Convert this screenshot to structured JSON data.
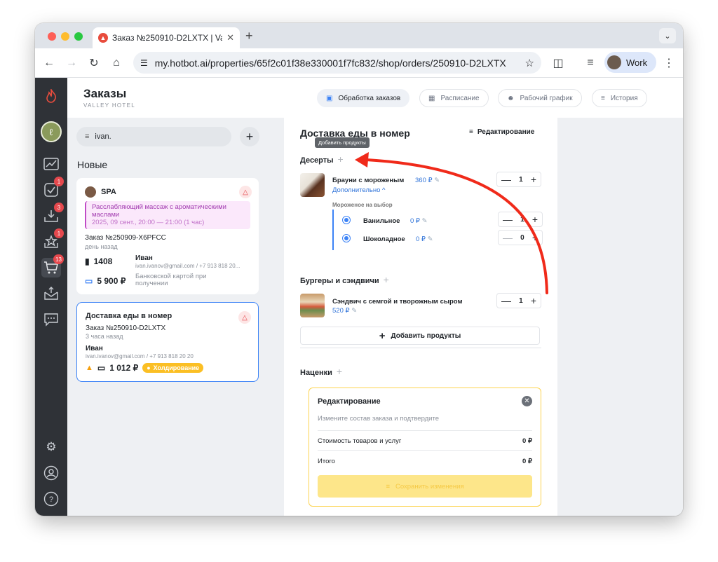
{
  "browser": {
    "tab_title": "Заказ №250910-D2LXTX | Va",
    "url": "my.hotbot.ai/properties/65f2c01f38e330001f7fc832/shop/orders/250910-D2LXTX",
    "profile_label": "Work"
  },
  "header": {
    "title": "Заказы",
    "subtitle": "VALLEY HOTEL",
    "tabs": [
      {
        "label": "Обработка заказов"
      },
      {
        "label": "Расписание"
      },
      {
        "label": "Рабочий график"
      },
      {
        "label": "История"
      }
    ]
  },
  "sidebar": {
    "badges": {
      "tasks": "1",
      "inbox": "3",
      "reviews": "1",
      "shop": "13"
    }
  },
  "search": {
    "value": "ivan."
  },
  "orders": {
    "section_title": "Новые",
    "cards": [
      {
        "title": "SPA",
        "service": "Расслабляющий массаж с ароматическими маслами",
        "service_time": "2025, 09 сент., 20:00 — 21:00  (1 час)",
        "order_no": "Заказ №250909-X6PFCC",
        "ago": "день назад",
        "room": "1408",
        "guest": "Иван",
        "contact": "ivan.ivanov@gmail.com / +7 913 818 20...",
        "amount": "5 900 ₽",
        "payment": "Банковской картой при получении"
      },
      {
        "title": "Доставка еды в номер",
        "order_no": "Заказ №250910-D2LXTX",
        "ago": "3 часа назад",
        "guest": "Иван",
        "contact": "ivan.ivanov@gmail.com / +7 913 818 20 20",
        "amount": "1 012 ₽",
        "status": "Холдирование"
      }
    ]
  },
  "detail": {
    "title": "Доставка еды в номер",
    "edit_label": "Редактирование",
    "tooltip": "Добавить продукты",
    "groups": {
      "desserts": {
        "label": "Десерты",
        "item_name": "Брауни с мороженым",
        "item_price": "360 ₽",
        "item_qty": "1",
        "more_label": "Дополнительно ^",
        "options_label": "Мороженое на выбор",
        "options": [
          {
            "name": "Ванильное",
            "price": "0 ₽",
            "qty": "1"
          },
          {
            "name": "Шоколадное",
            "price": "0 ₽",
            "qty": "0"
          }
        ]
      },
      "burgers": {
        "label": "Бургеры и сэндвичи",
        "item_name": "Сэндвич с семгой и творожным сыром",
        "item_price": "520 ₽",
        "item_qty": "1",
        "add_label": "Добавить продукты"
      },
      "markups": {
        "label": "Наценки"
      }
    },
    "edit_panel": {
      "title": "Редактирование",
      "hint": "Измените состав заказа и подтвердите",
      "rows": [
        {
          "label": "Стоимость товаров и услуг",
          "value": "0 ₽"
        },
        {
          "label": "Итого",
          "value": "0 ₽"
        }
      ],
      "save_label": "Сохранить изменения"
    }
  },
  "colors": {
    "accent": "#3b82f6",
    "annotation_arrow": "#f02a1a",
    "hold": "#fbbf24"
  }
}
